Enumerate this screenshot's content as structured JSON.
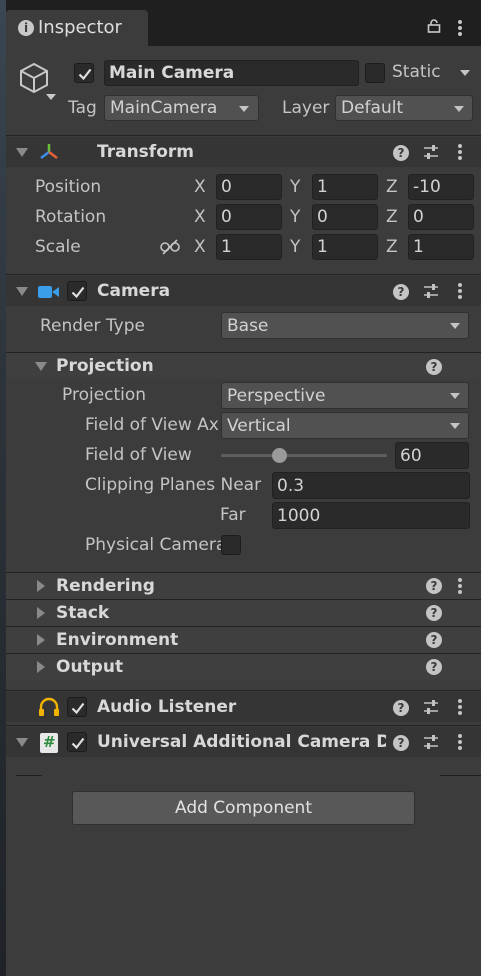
{
  "tab": {
    "title": "Inspector"
  },
  "gameobject": {
    "active": true,
    "name": "Main Camera",
    "static_label": "Static",
    "tag_label": "Tag",
    "tag_value": "MainCamera",
    "layer_label": "Layer",
    "layer_value": "Default"
  },
  "transform": {
    "title": "Transform",
    "rows": [
      {
        "label": "Position",
        "x": "0",
        "y": "1",
        "z": "-10"
      },
      {
        "label": "Rotation",
        "x": "0",
        "y": "0",
        "z": "0"
      },
      {
        "label": "Scale",
        "x": "1",
        "y": "1",
        "z": "1"
      }
    ],
    "axis": {
      "x": "X",
      "y": "Y",
      "z": "Z"
    }
  },
  "camera": {
    "title": "Camera",
    "render_type_label": "Render Type",
    "render_type_value": "Base",
    "projection_section": "Projection",
    "projection_label": "Projection",
    "projection_value": "Perspective",
    "fov_axis_label": "Field of View Ax",
    "fov_axis_value": "Vertical",
    "fov_label": "Field of View",
    "fov_value": "60",
    "fov_slider_fraction": 0.35,
    "near_label": "Clipping Planes Near",
    "near_value": "0.3",
    "far_label": "Far",
    "far_value": "1000",
    "physical_label": "Physical Camera",
    "sections": [
      "Rendering",
      "Stack",
      "Environment",
      "Output"
    ]
  },
  "audio_listener": {
    "title": "Audio Listener"
  },
  "additional_data": {
    "title": "Universal Additional Camera Data"
  },
  "add_component": "Add Component",
  "icons": {
    "help": "?",
    "component_script": "#"
  },
  "colors": {
    "panel": "#3c3c3c",
    "header": "#353535",
    "field": "#2a2a2a",
    "dropdown": "#515151",
    "text": "#d2d2d2"
  }
}
